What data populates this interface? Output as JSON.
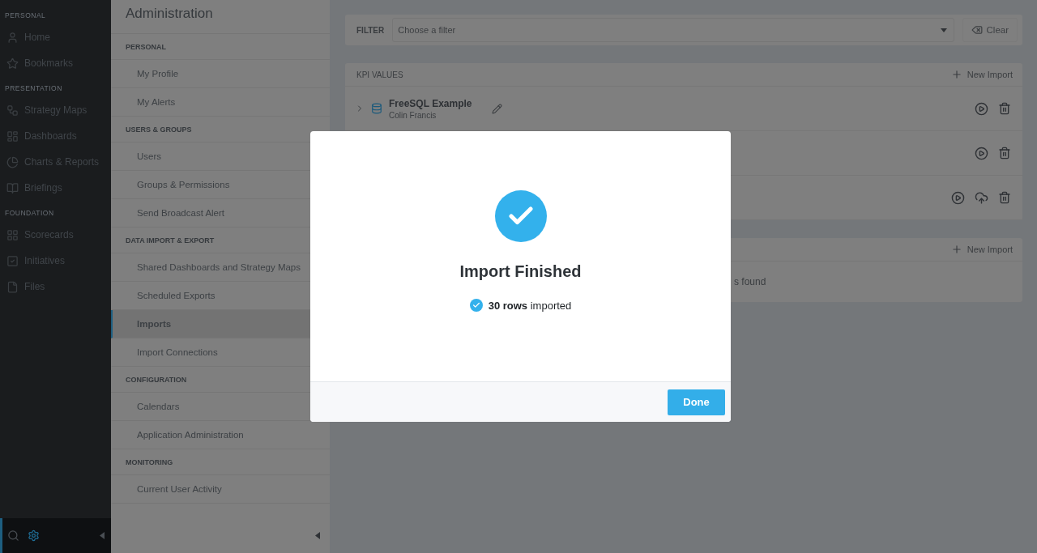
{
  "nav": {
    "sections": [
      {
        "title": "PERSONAL",
        "items": [
          {
            "label": "Home"
          },
          {
            "label": "Bookmarks"
          }
        ]
      },
      {
        "title": "PRESENTATION",
        "items": [
          {
            "label": "Strategy Maps"
          },
          {
            "label": "Dashboards"
          },
          {
            "label": "Charts & Reports"
          },
          {
            "label": "Briefings"
          }
        ]
      },
      {
        "title": "FOUNDATION",
        "items": [
          {
            "label": "Scorecards"
          },
          {
            "label": "Initiatives"
          },
          {
            "label": "Files"
          }
        ]
      }
    ]
  },
  "admin": {
    "title": "Administration",
    "sections": [
      {
        "title": "PERSONAL",
        "items": [
          {
            "label": "My Profile",
            "selected": false
          },
          {
            "label": "My Alerts",
            "selected": false
          }
        ]
      },
      {
        "title": "USERS & GROUPS",
        "items": [
          {
            "label": "Users",
            "selected": false
          },
          {
            "label": "Groups & Permissions",
            "selected": false
          },
          {
            "label": "Send Broadcast Alert",
            "selected": false
          }
        ]
      },
      {
        "title": "DATA IMPORT & EXPORT",
        "items": [
          {
            "label": "Shared Dashboards and Strategy Maps",
            "selected": false
          },
          {
            "label": "Scheduled Exports",
            "selected": false
          },
          {
            "label": "Imports",
            "selected": true
          },
          {
            "label": "Import Connections",
            "selected": false
          }
        ]
      },
      {
        "title": "CONFIGURATION",
        "items": [
          {
            "label": "Calendars",
            "selected": false
          },
          {
            "label": "Application Administration",
            "selected": false
          }
        ]
      },
      {
        "title": "MONITORING",
        "items": [
          {
            "label": "Current User Activity",
            "selected": false
          }
        ]
      }
    ]
  },
  "filter": {
    "label": "FILTER",
    "placeholder": "Choose a filter",
    "clear": "Clear"
  },
  "kpi_panel": {
    "title": "KPI VALUES",
    "new_import": "New Import",
    "rows": [
      {
        "kind": "named",
        "name": "FreeSQL Example",
        "author": "Colin Francis"
      },
      {
        "kind": "plain"
      },
      {
        "kind": "upload"
      }
    ]
  },
  "second_panel": {
    "new_import": "New Import",
    "message": "s found"
  },
  "modal": {
    "title": "Import Finished",
    "message": "**30 rows** imported",
    "button": "Done"
  }
}
